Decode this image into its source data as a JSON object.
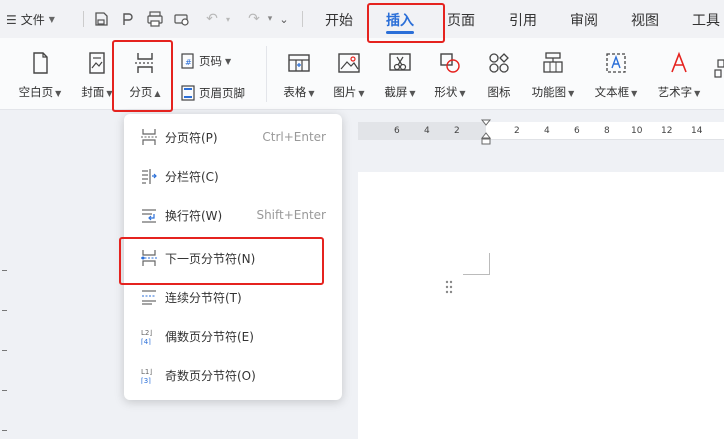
{
  "topbar": {
    "file_menu": "文件",
    "tabs": [
      "开始",
      "插入",
      "页面",
      "引用",
      "审阅",
      "视图",
      "工具"
    ],
    "active_tab": "插入"
  },
  "ribbon": {
    "blank_page": "空白页",
    "cover": "封面",
    "page_break": "分页",
    "page_number": "页码",
    "header_footer": "页眉页脚",
    "table": "表格",
    "image": "图片",
    "screenshot": "截屏",
    "shape": "形状",
    "icon": "图标",
    "function_chart": "功能图",
    "text_box": "文本框",
    "wordart": "艺术字"
  },
  "ruler": {
    "numbers": [
      "6",
      "4",
      "2",
      "2",
      "4",
      "6",
      "8",
      "10",
      "12",
      "14"
    ]
  },
  "dropdown": {
    "items": [
      {
        "label": "分页符(P)",
        "shortcut": "Ctrl+Enter"
      },
      {
        "label": "分栏符(C)",
        "shortcut": ""
      },
      {
        "label": "换行符(W)",
        "shortcut": "Shift+Enter"
      },
      {
        "label": "下一页分节符(N)",
        "shortcut": ""
      },
      {
        "label": "连续分节符(T)",
        "shortcut": ""
      },
      {
        "label": "偶数页分节符(E)",
        "shortcut": ""
      },
      {
        "label": "奇数页分节符(O)",
        "shortcut": ""
      }
    ]
  },
  "colors": {
    "highlight": "#e5231f",
    "accent": "#2b6fd8"
  }
}
